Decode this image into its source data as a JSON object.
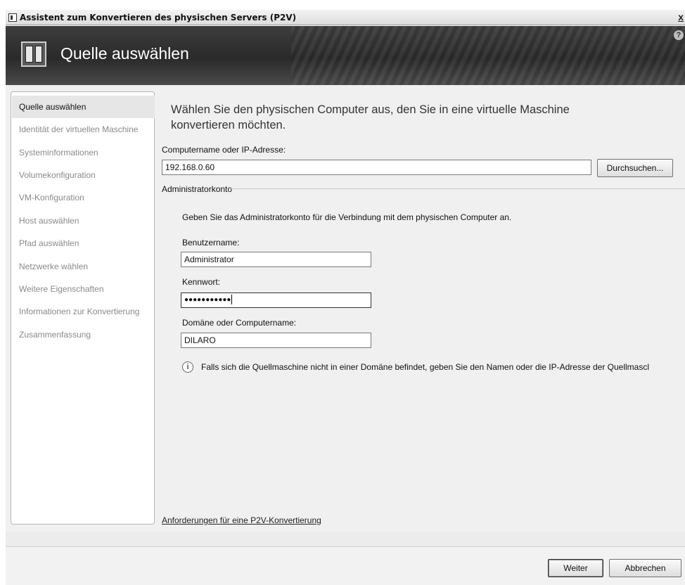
{
  "window": {
    "title": "Assistent zum Konvertieren des physischen Servers (P2V)",
    "close_label": "x"
  },
  "banner": {
    "title": "Quelle auswählen",
    "help_label": "?"
  },
  "nav": {
    "items": [
      {
        "label": "Quelle auswählen",
        "active": true
      },
      {
        "label": "Identität der virtuellen Maschine",
        "active": false
      },
      {
        "label": "Systeminformationen",
        "active": false
      },
      {
        "label": "Volumekonfiguration",
        "active": false
      },
      {
        "label": "VM-Konfiguration",
        "active": false
      },
      {
        "label": "Host auswählen",
        "active": false
      },
      {
        "label": "Pfad auswählen",
        "active": false
      },
      {
        "label": "Netzwerke wählen",
        "active": false
      },
      {
        "label": "Weitere Eigenschaften",
        "active": false
      },
      {
        "label": "Informationen zur Konvertierung",
        "active": false
      },
      {
        "label": "Zusammenfassung",
        "active": false
      }
    ]
  },
  "main": {
    "heading": "Wählen Sie den physischen Computer aus, den Sie in eine virtuelle Maschine konvertieren möchten.",
    "computer_label": "Computername oder IP-Adresse:",
    "computer_value": "192.168.0.60",
    "browse_label": "Durchsuchen...",
    "admin_section_label": "Administratorkonto",
    "admin_description": "Geben Sie das Administratorkonto für die Verbindung mit dem physischen Computer an.",
    "username_label": "Benutzername:",
    "username_value": "Administrator",
    "password_label": "Kennwort:",
    "password_mask": "●●●●●●●●●●●",
    "domain_label": "Domäne oder Computername:",
    "domain_value": "DILARO",
    "info_icon": "i",
    "info_text": "Falls sich die Quellmaschine nicht in einer Domäne befindet, geben Sie den Namen oder die IP-Adresse der Quellmascl",
    "requirements_link": "Anforderungen für eine P2V-Konvertierung"
  },
  "footer": {
    "next_label": "Weiter",
    "cancel_label": "Abbrechen"
  }
}
